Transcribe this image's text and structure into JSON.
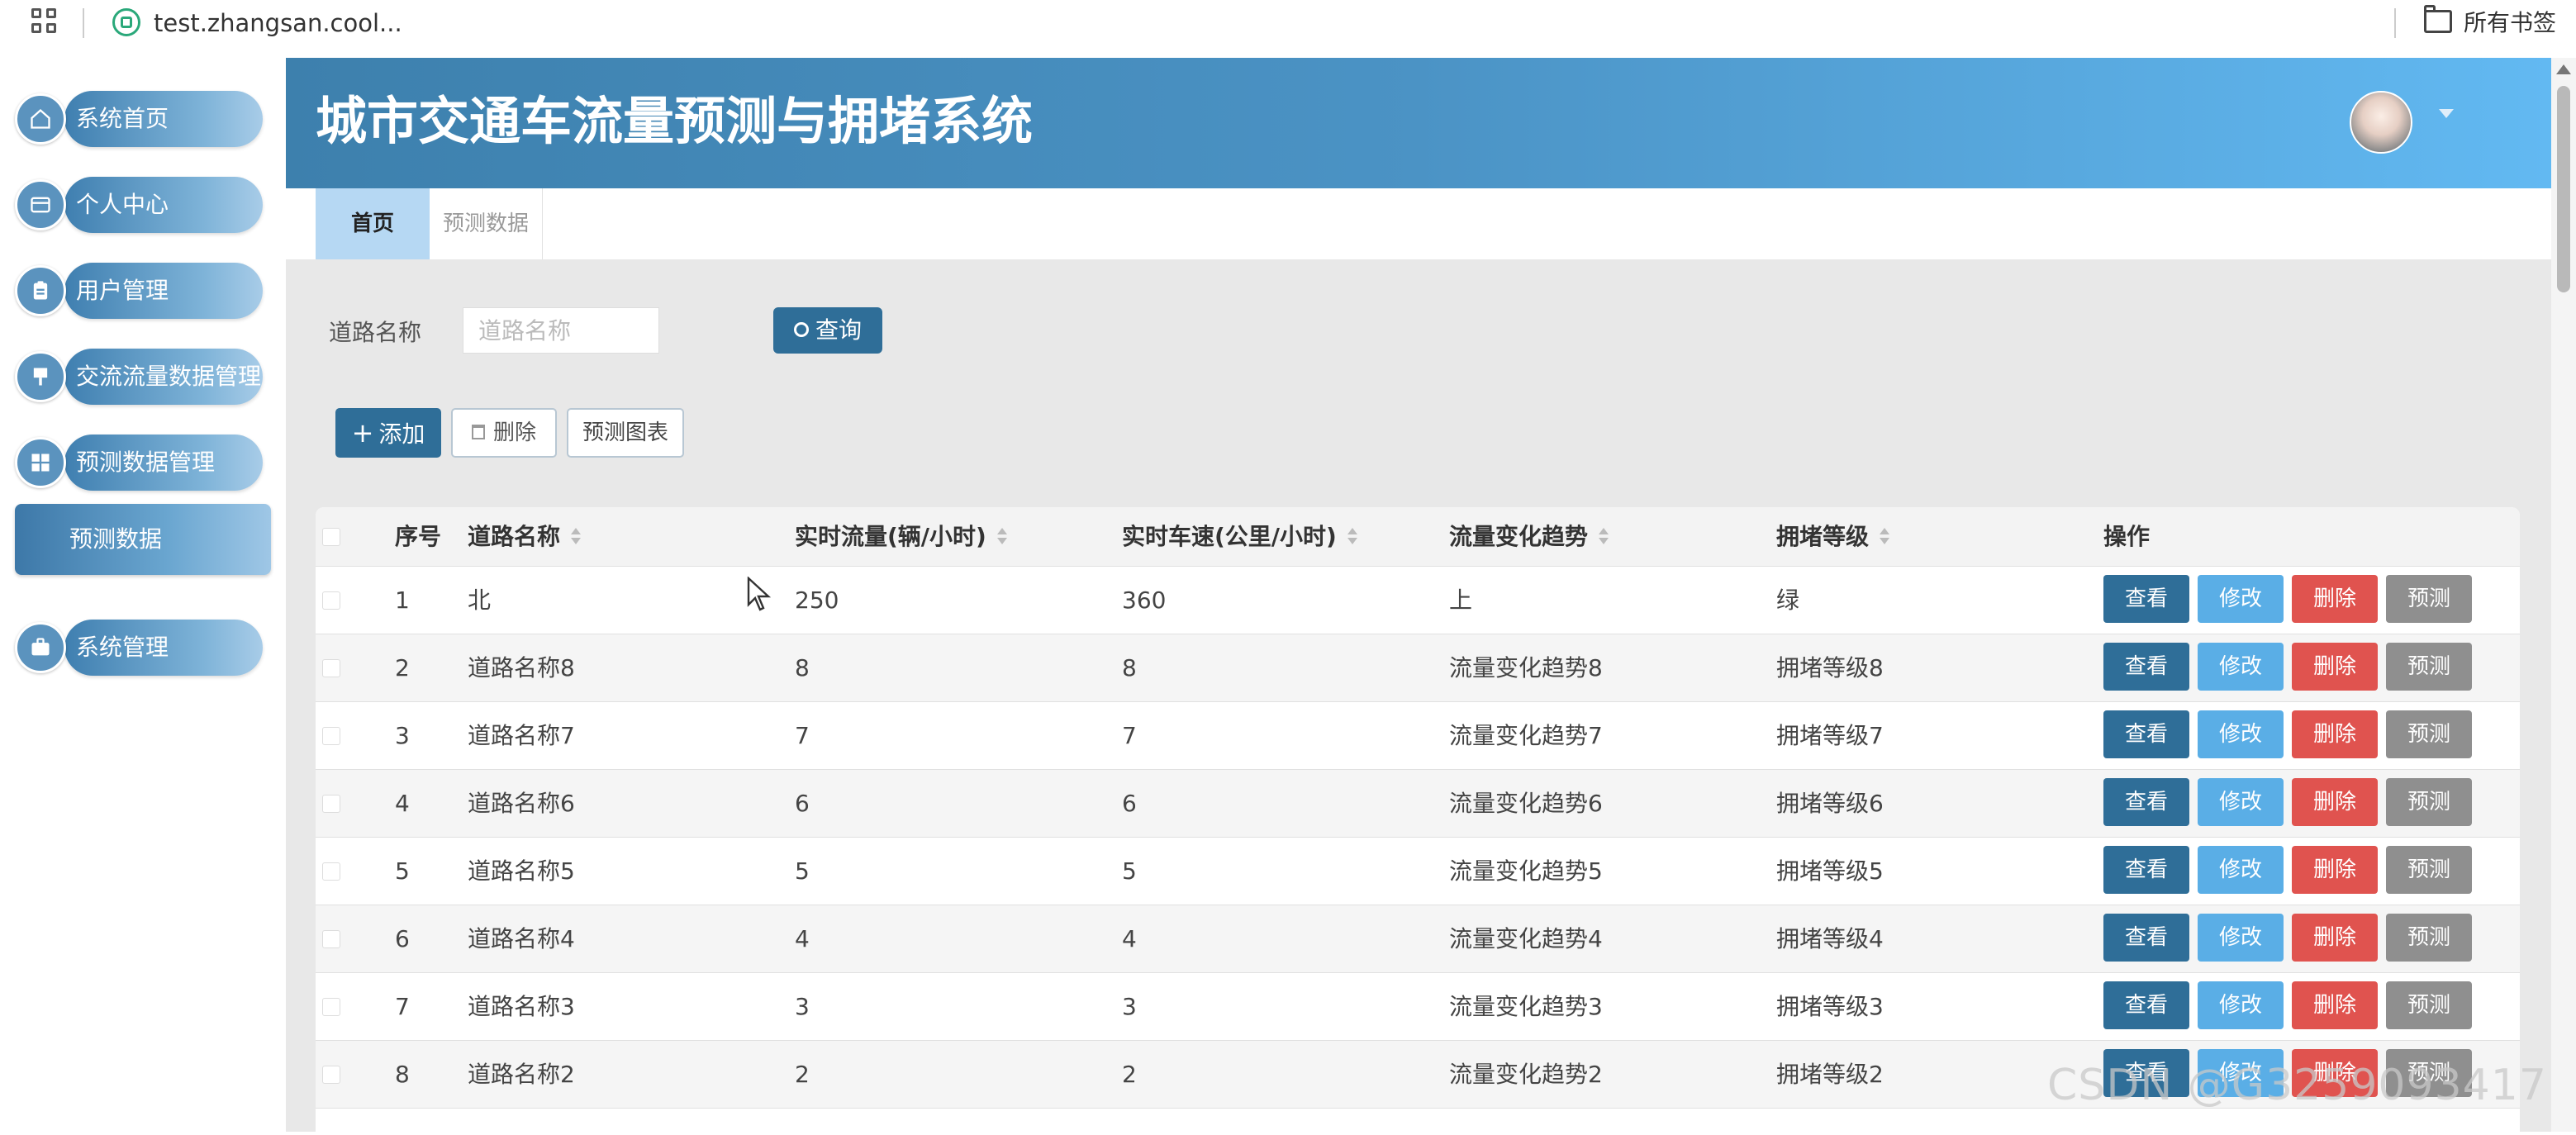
{
  "browser": {
    "url": "test.zhangsan.cool...",
    "bookmarks_label": "所有书签"
  },
  "sidebar": {
    "items": [
      {
        "label": "系统首页",
        "icon": "home-icon"
      },
      {
        "label": "个人中心",
        "icon": "wallet-icon"
      },
      {
        "label": "用户管理",
        "icon": "clipboard-icon"
      },
      {
        "label": "交流流量数据管理",
        "icon": "flag-icon"
      },
      {
        "label": "预测数据管理",
        "icon": "grid-icon"
      },
      {
        "label": "系统管理",
        "icon": "briefcase-icon"
      }
    ],
    "sub_item": "预测数据"
  },
  "header": {
    "title": "城市交通车流量预测与拥堵系统"
  },
  "tabs": [
    "首页",
    "预测数据"
  ],
  "search": {
    "label": "道路名称",
    "placeholder": "道路名称",
    "button": "查询"
  },
  "toolbar": {
    "add": "添加",
    "delete": "删除",
    "chart": "预测图表"
  },
  "table": {
    "columns": [
      "序号",
      "道路名称",
      "实时流量(辆/小时)",
      "实时车速(公里/小时)",
      "流量变化趋势",
      "拥堵等级",
      "操作"
    ],
    "actions": [
      "查看",
      "修改",
      "删除",
      "预测"
    ],
    "rows": [
      [
        "1",
        "北",
        "250",
        "360",
        "上",
        "绿"
      ],
      [
        "2",
        "道路名称8",
        "8",
        "8",
        "流量变化趋势8",
        "拥堵等级8"
      ],
      [
        "3",
        "道路名称7",
        "7",
        "7",
        "流量变化趋势7",
        "拥堵等级7"
      ],
      [
        "4",
        "道路名称6",
        "6",
        "6",
        "流量变化趋势6",
        "拥堵等级6"
      ],
      [
        "5",
        "道路名称5",
        "5",
        "5",
        "流量变化趋势5",
        "拥堵等级5"
      ],
      [
        "6",
        "道路名称4",
        "4",
        "4",
        "流量变化趋势4",
        "拥堵等级4"
      ],
      [
        "7",
        "道路名称3",
        "3",
        "3",
        "流量变化趋势3",
        "拥堵等级3"
      ],
      [
        "8",
        "道路名称2",
        "2",
        "2",
        "流量变化趋势2",
        "拥堵等级2"
      ]
    ]
  },
  "watermark": "CSDN @G3259093417",
  "colors": {
    "primary": "#2f6e98",
    "edit": "#5aaee6",
    "danger": "#e0534f",
    "neutral": "#8f8f8f",
    "header_start": "#3d80ad",
    "header_end": "#62b9f2",
    "tab_active": "#b6d8f3"
  }
}
